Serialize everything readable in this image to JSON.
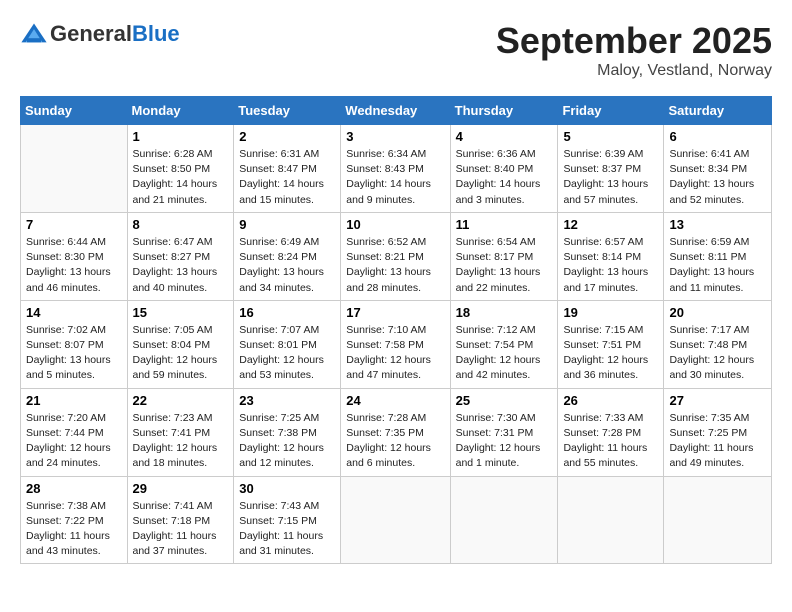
{
  "header": {
    "logo_general": "General",
    "logo_blue": "Blue",
    "month_title": "September 2025",
    "location": "Maloy, Vestland, Norway"
  },
  "days_of_week": [
    "Sunday",
    "Monday",
    "Tuesday",
    "Wednesday",
    "Thursday",
    "Friday",
    "Saturday"
  ],
  "weeks": [
    [
      {
        "day": "",
        "info": ""
      },
      {
        "day": "1",
        "info": "Sunrise: 6:28 AM\nSunset: 8:50 PM\nDaylight: 14 hours\nand 21 minutes."
      },
      {
        "day": "2",
        "info": "Sunrise: 6:31 AM\nSunset: 8:47 PM\nDaylight: 14 hours\nand 15 minutes."
      },
      {
        "day": "3",
        "info": "Sunrise: 6:34 AM\nSunset: 8:43 PM\nDaylight: 14 hours\nand 9 minutes."
      },
      {
        "day": "4",
        "info": "Sunrise: 6:36 AM\nSunset: 8:40 PM\nDaylight: 14 hours\nand 3 minutes."
      },
      {
        "day": "5",
        "info": "Sunrise: 6:39 AM\nSunset: 8:37 PM\nDaylight: 13 hours\nand 57 minutes."
      },
      {
        "day": "6",
        "info": "Sunrise: 6:41 AM\nSunset: 8:34 PM\nDaylight: 13 hours\nand 52 minutes."
      }
    ],
    [
      {
        "day": "7",
        "info": "Sunrise: 6:44 AM\nSunset: 8:30 PM\nDaylight: 13 hours\nand 46 minutes."
      },
      {
        "day": "8",
        "info": "Sunrise: 6:47 AM\nSunset: 8:27 PM\nDaylight: 13 hours\nand 40 minutes."
      },
      {
        "day": "9",
        "info": "Sunrise: 6:49 AM\nSunset: 8:24 PM\nDaylight: 13 hours\nand 34 minutes."
      },
      {
        "day": "10",
        "info": "Sunrise: 6:52 AM\nSunset: 8:21 PM\nDaylight: 13 hours\nand 28 minutes."
      },
      {
        "day": "11",
        "info": "Sunrise: 6:54 AM\nSunset: 8:17 PM\nDaylight: 13 hours\nand 22 minutes."
      },
      {
        "day": "12",
        "info": "Sunrise: 6:57 AM\nSunset: 8:14 PM\nDaylight: 13 hours\nand 17 minutes."
      },
      {
        "day": "13",
        "info": "Sunrise: 6:59 AM\nSunset: 8:11 PM\nDaylight: 13 hours\nand 11 minutes."
      }
    ],
    [
      {
        "day": "14",
        "info": "Sunrise: 7:02 AM\nSunset: 8:07 PM\nDaylight: 13 hours\nand 5 minutes."
      },
      {
        "day": "15",
        "info": "Sunrise: 7:05 AM\nSunset: 8:04 PM\nDaylight: 12 hours\nand 59 minutes."
      },
      {
        "day": "16",
        "info": "Sunrise: 7:07 AM\nSunset: 8:01 PM\nDaylight: 12 hours\nand 53 minutes."
      },
      {
        "day": "17",
        "info": "Sunrise: 7:10 AM\nSunset: 7:58 PM\nDaylight: 12 hours\nand 47 minutes."
      },
      {
        "day": "18",
        "info": "Sunrise: 7:12 AM\nSunset: 7:54 PM\nDaylight: 12 hours\nand 42 minutes."
      },
      {
        "day": "19",
        "info": "Sunrise: 7:15 AM\nSunset: 7:51 PM\nDaylight: 12 hours\nand 36 minutes."
      },
      {
        "day": "20",
        "info": "Sunrise: 7:17 AM\nSunset: 7:48 PM\nDaylight: 12 hours\nand 30 minutes."
      }
    ],
    [
      {
        "day": "21",
        "info": "Sunrise: 7:20 AM\nSunset: 7:44 PM\nDaylight: 12 hours\nand 24 minutes."
      },
      {
        "day": "22",
        "info": "Sunrise: 7:23 AM\nSunset: 7:41 PM\nDaylight: 12 hours\nand 18 minutes."
      },
      {
        "day": "23",
        "info": "Sunrise: 7:25 AM\nSunset: 7:38 PM\nDaylight: 12 hours\nand 12 minutes."
      },
      {
        "day": "24",
        "info": "Sunrise: 7:28 AM\nSunset: 7:35 PM\nDaylight: 12 hours\nand 6 minutes."
      },
      {
        "day": "25",
        "info": "Sunrise: 7:30 AM\nSunset: 7:31 PM\nDaylight: 12 hours\nand 1 minute."
      },
      {
        "day": "26",
        "info": "Sunrise: 7:33 AM\nSunset: 7:28 PM\nDaylight: 11 hours\nand 55 minutes."
      },
      {
        "day": "27",
        "info": "Sunrise: 7:35 AM\nSunset: 7:25 PM\nDaylight: 11 hours\nand 49 minutes."
      }
    ],
    [
      {
        "day": "28",
        "info": "Sunrise: 7:38 AM\nSunset: 7:22 PM\nDaylight: 11 hours\nand 43 minutes."
      },
      {
        "day": "29",
        "info": "Sunrise: 7:41 AM\nSunset: 7:18 PM\nDaylight: 11 hours\nand 37 minutes."
      },
      {
        "day": "30",
        "info": "Sunrise: 7:43 AM\nSunset: 7:15 PM\nDaylight: 11 hours\nand 31 minutes."
      },
      {
        "day": "",
        "info": ""
      },
      {
        "day": "",
        "info": ""
      },
      {
        "day": "",
        "info": ""
      },
      {
        "day": "",
        "info": ""
      }
    ]
  ]
}
